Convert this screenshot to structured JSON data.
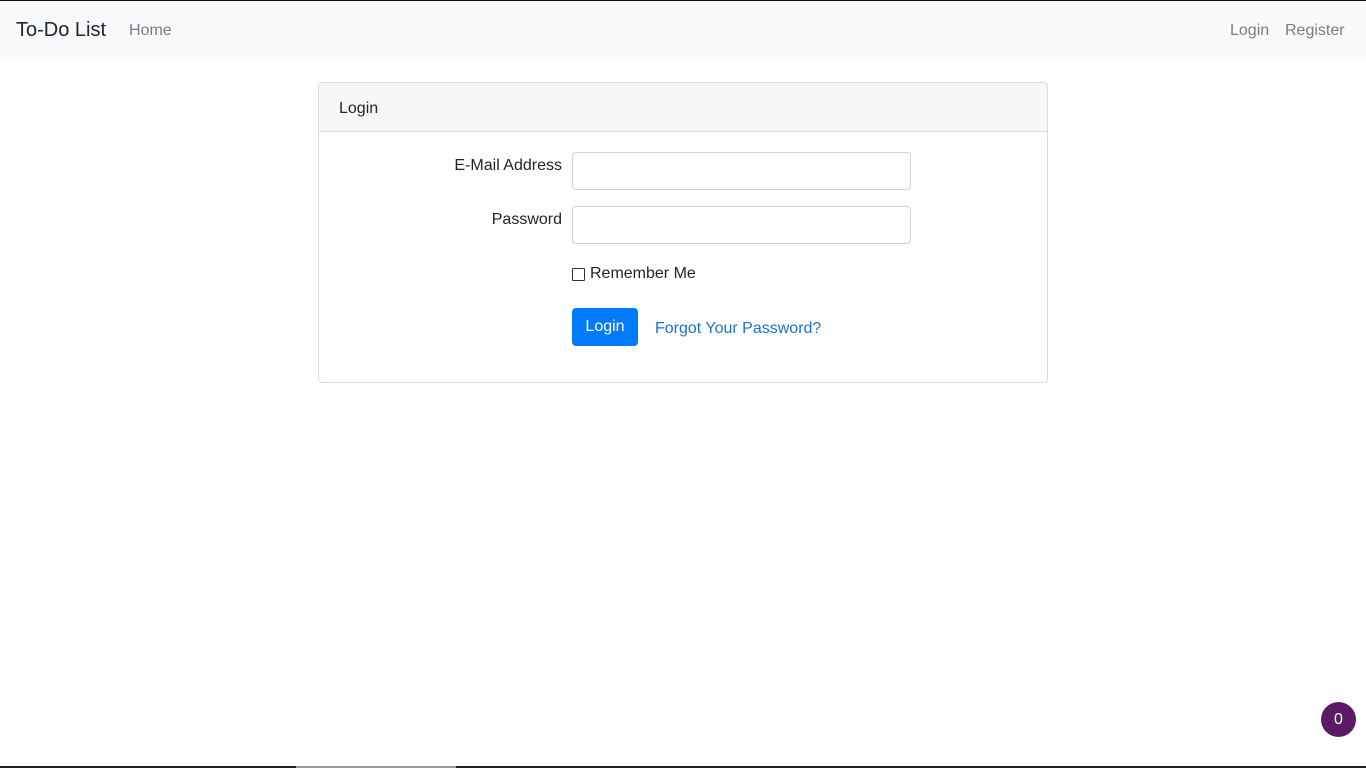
{
  "navbar": {
    "brand": "To-Do List",
    "home_label": "Home",
    "login_label": "Login",
    "register_label": "Register"
  },
  "card": {
    "title": "Login",
    "email_label": "E-Mail Address",
    "email_value": "",
    "password_label": "Password",
    "password_value": "",
    "remember_label": "Remember Me",
    "remember_checked": false,
    "login_button": "Login",
    "forgot_link": "Forgot Your Password?"
  },
  "notification_badge": {
    "count": "0"
  },
  "colors": {
    "primary": "#007bff",
    "link": "#1a73c8",
    "navbar_bg": "#f8f9fa",
    "badge": "#5c1a66"
  }
}
